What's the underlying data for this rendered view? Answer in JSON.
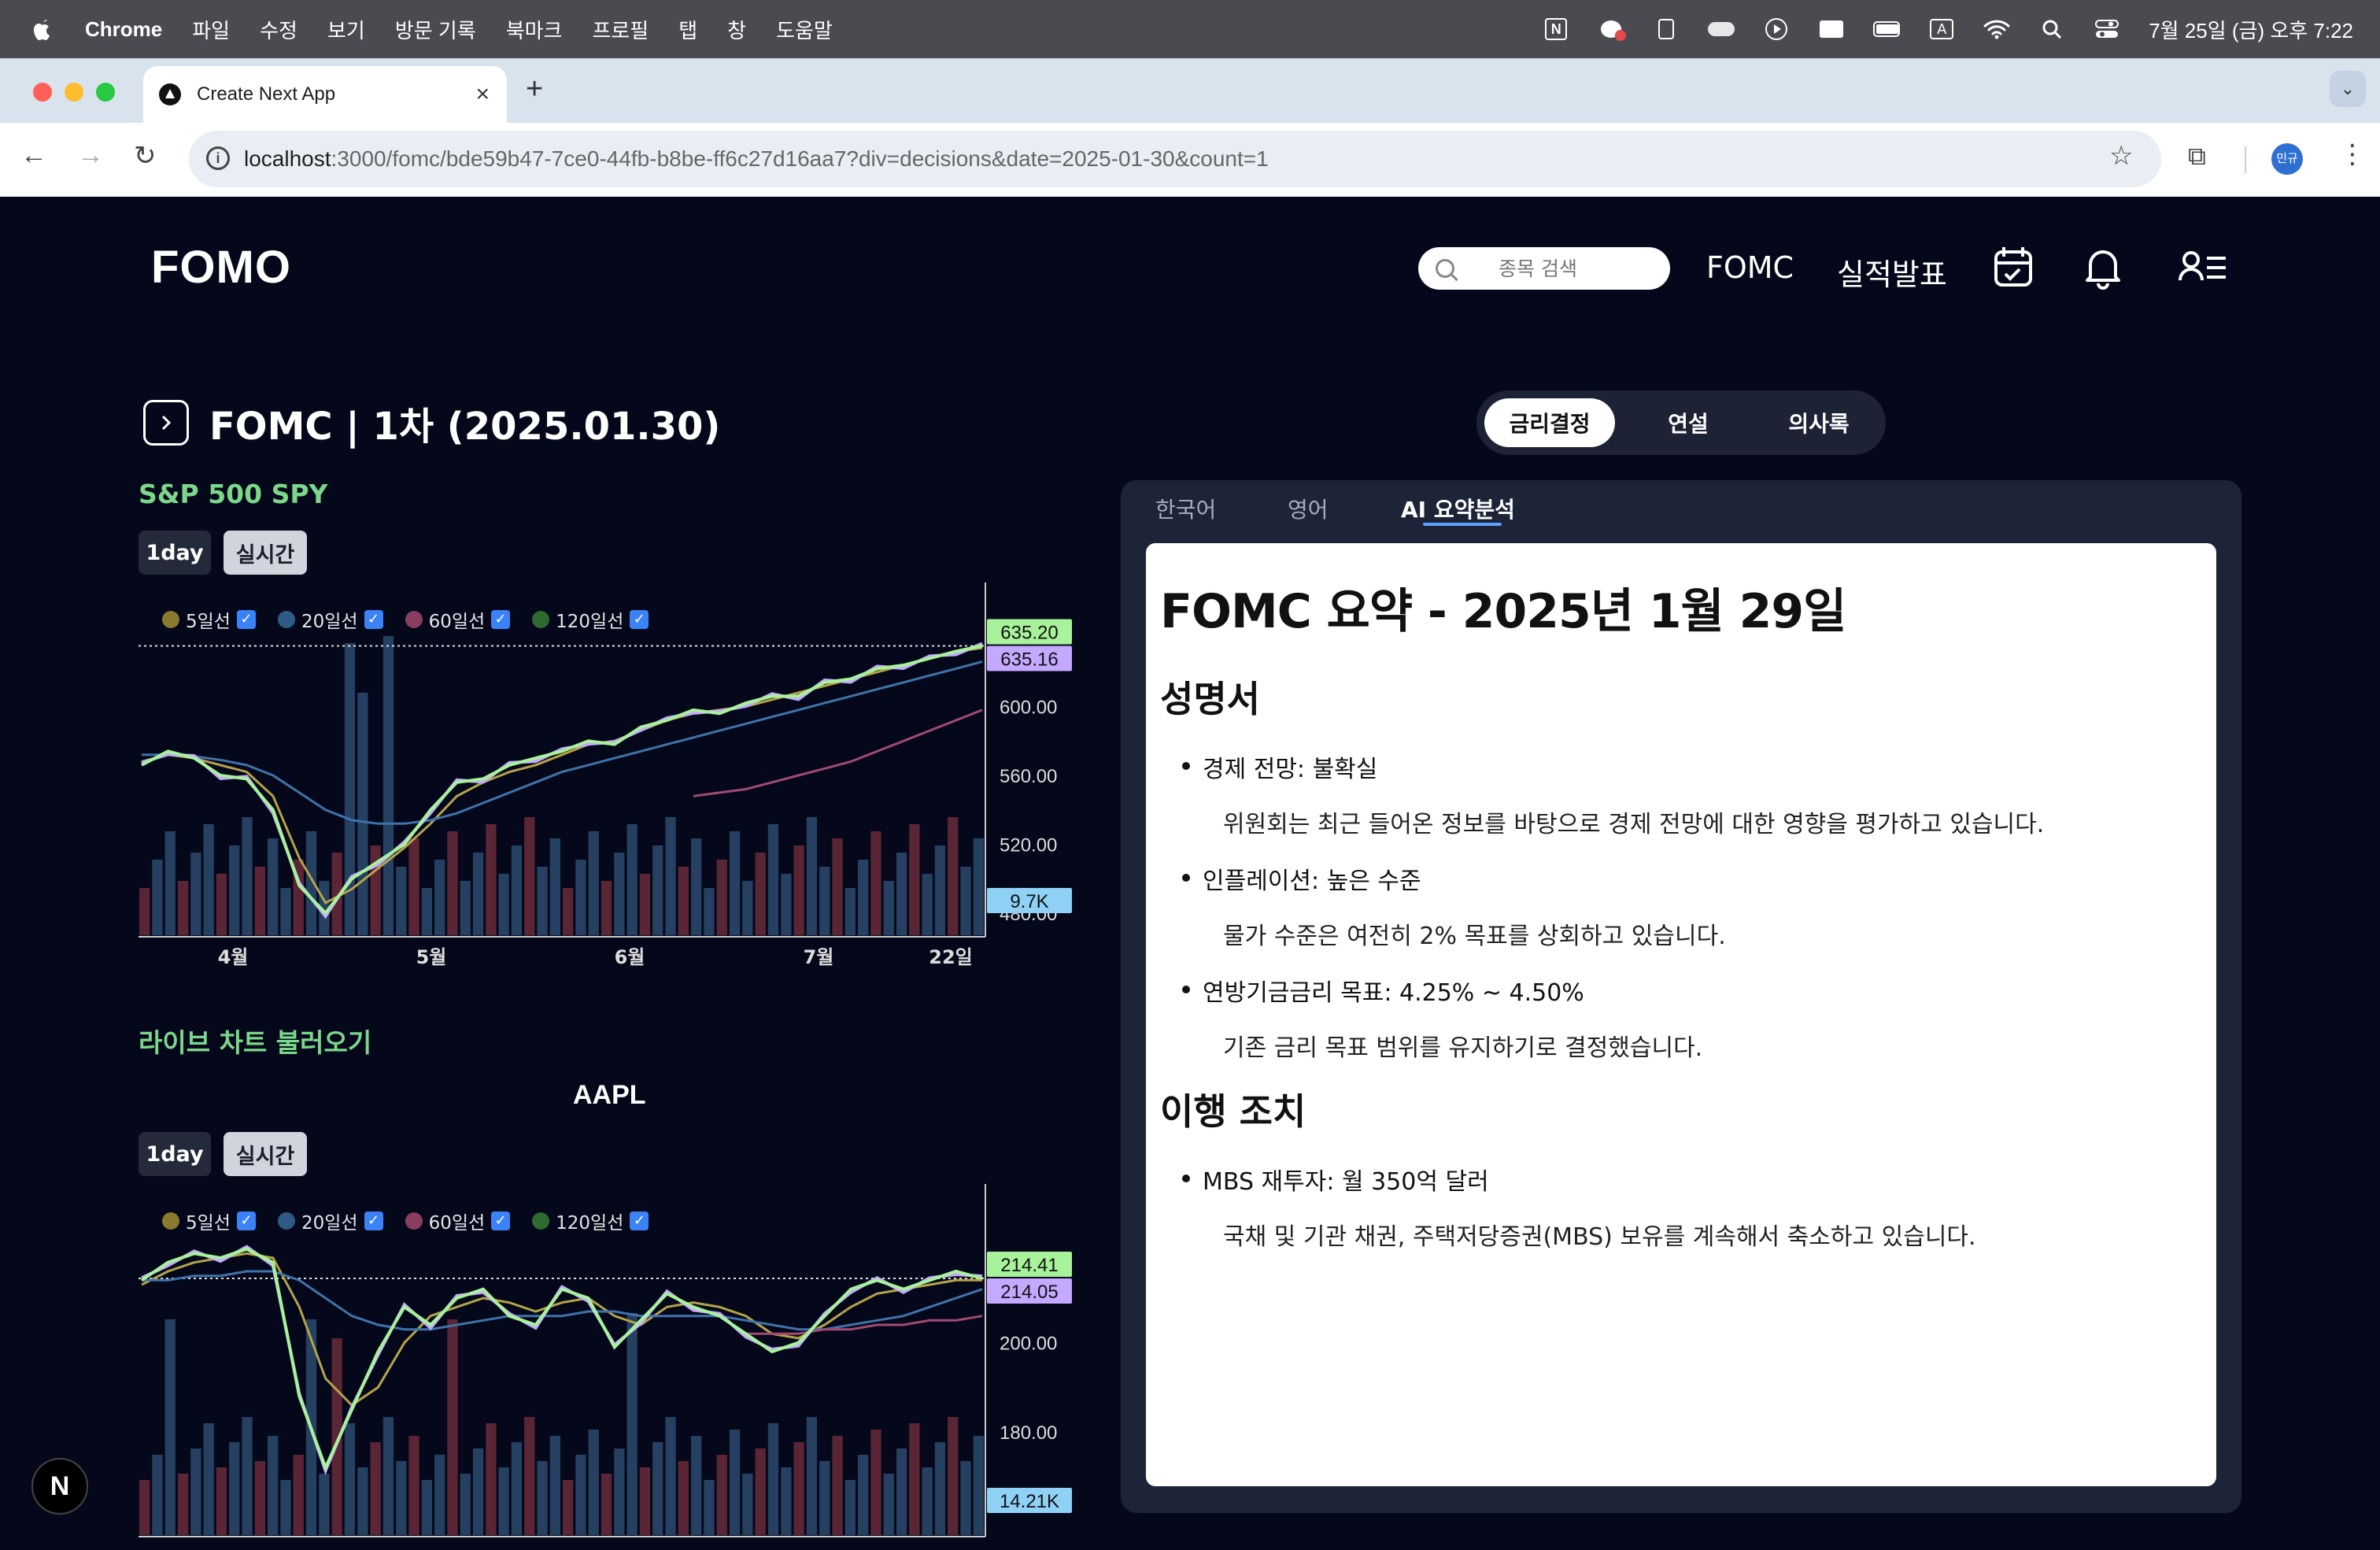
{
  "menubar": {
    "app": "Chrome",
    "items": [
      "파일",
      "수정",
      "보기",
      "방문 기록",
      "북마크",
      "프로필",
      "탭",
      "창",
      "도움말"
    ],
    "clock": "7월 25일 (금) 오후 7:22",
    "input_indicator": "A"
  },
  "browser": {
    "tab_title": "Create Next App",
    "url_host": "localhost",
    "url_rest": ":3000/fomc/bde59b47-7ce0-44fb-b8be-ff6c27d16aa7?div=decisions&date=2025-01-30&count=1",
    "profile_label": "민규"
  },
  "site": {
    "logo": "FOMO",
    "search_placeholder": "종목 검색",
    "nav": [
      "FOMC",
      "실적발표"
    ]
  },
  "fomc": {
    "title": "FOMC | 1차 (2025.01.30)",
    "segments": [
      "금리결정",
      "연설",
      "의사록"
    ],
    "active_segment": "금리결정",
    "lang_tabs": [
      "한국어",
      "영어",
      "AI 요약분석"
    ],
    "active_lang": "AI 요약분석"
  },
  "chart_spy": {
    "heading": "S&P 500 SPY",
    "btn_1day": "1day",
    "btn_live": "실시간",
    "legend": [
      {
        "label": "5일선",
        "color": "#8a7a2e"
      },
      {
        "label": "20일선",
        "color": "#2e5a86"
      },
      {
        "label": "60일선",
        "color": "#8a3d5f"
      },
      {
        "label": "120일선",
        "color": "#2f6a2f"
      }
    ]
  },
  "chart_aapl": {
    "heading": "라이브 차트 불러오기",
    "symbol": "AAPL",
    "btn_1day": "1day",
    "btn_live": "실시간"
  },
  "chart_data": [
    {
      "type": "line",
      "title": "S&P 500 SPY",
      "x_ticks": [
        "4월",
        "5월",
        "6월",
        "7월",
        "22일"
      ],
      "y_ticks": [
        "600.00",
        "560.00",
        "520.00",
        "480.00"
      ],
      "ylim": [
        480,
        640
      ],
      "price_label_last": "635.20",
      "price_label_ma": "635.16",
      "volume_label": "9.7K",
      "series": [
        {
          "name": "5일선",
          "values": [
            568,
            572,
            570,
            566,
            562,
            548,
            512,
            486,
            494,
            506,
            518,
            532,
            548,
            556,
            562,
            566,
            572,
            578,
            580,
            586,
            592,
            596,
            598,
            600,
            604,
            608,
            612,
            616,
            620,
            624,
            628,
            632,
            634
          ]
        },
        {
          "name": "20일선",
          "values": [
            572,
            572,
            571,
            569,
            566,
            560,
            550,
            540,
            534,
            532,
            532,
            534,
            538,
            544,
            550,
            556,
            562,
            566,
            570,
            574,
            578,
            582,
            586,
            590,
            594,
            598,
            602,
            606,
            610,
            614,
            618,
            622,
            626
          ]
        },
        {
          "name": "60일선",
          "values": [
            null,
            null,
            null,
            null,
            null,
            null,
            null,
            null,
            null,
            null,
            null,
            null,
            null,
            null,
            null,
            null,
            null,
            null,
            null,
            null,
            null,
            548,
            550,
            552,
            556,
            560,
            564,
            568,
            574,
            580,
            586,
            592,
            598
          ]
        }
      ],
      "price": [
        566,
        574,
        570,
        560,
        558,
        540,
        496,
        480,
        500,
        510,
        520,
        540,
        556,
        558,
        566,
        570,
        574,
        580,
        578,
        588,
        592,
        598,
        596,
        602,
        606,
        606,
        614,
        616,
        622,
        624,
        628,
        632,
        635.2
      ]
    },
    {
      "type": "line",
      "title": "AAPL",
      "x_ticks": [],
      "y_ticks": [
        "200.00",
        "180.00"
      ],
      "ylim": [
        165,
        225
      ],
      "price_label_last": "214.41",
      "price_label_ma": "214.05",
      "volume_label": "14.21K",
      "price": [
        214,
        218,
        220,
        219,
        221,
        218,
        188,
        172,
        185,
        198,
        208,
        204,
        210,
        212,
        206,
        204,
        212,
        210,
        199,
        205,
        211,
        208,
        206,
        202,
        198,
        200,
        206,
        212,
        214,
        212,
        214,
        216,
        214.41
      ],
      "series": [
        {
          "name": "5일선",
          "values": [
            213,
            216,
            218,
            219,
            220,
            219,
            208,
            192,
            186,
            190,
            200,
            206,
            208,
            210,
            209,
            207,
            209,
            210,
            206,
            204,
            208,
            209,
            208,
            206,
            202,
            201,
            204,
            208,
            211,
            212,
            213,
            214,
            214
          ]
        },
        {
          "name": "20일선",
          "values": [
            214,
            214,
            215,
            215,
            216,
            216,
            214,
            210,
            206,
            204,
            203,
            203,
            204,
            205,
            206,
            206,
            206,
            207,
            207,
            206,
            206,
            206,
            206,
            205,
            204,
            203,
            203,
            204,
            205,
            206,
            208,
            210,
            212
          ]
        },
        {
          "name": "60일선",
          "values": [
            null,
            null,
            null,
            null,
            null,
            null,
            null,
            null,
            null,
            null,
            null,
            null,
            null,
            null,
            null,
            null,
            null,
            null,
            null,
            null,
            null,
            null,
            null,
            202,
            202,
            202,
            203,
            203,
            204,
            204,
            205,
            205,
            206
          ]
        }
      ]
    }
  ],
  "summary": {
    "h1": "FOMC 요약 - 2025년 1월 29일",
    "section1": "성명서",
    "items1": [
      {
        "bullet": "경제 전망: 불확실",
        "para": "위원회는 최근 들어온 정보를 바탕으로 경제 전망에 대한 영향을 평가하고 있습니다."
      },
      {
        "bullet": "인플레이션: 높은 수준",
        "para": "물가 수준은 여전히 2% 목표를 상회하고 있습니다."
      },
      {
        "bullet": "연방기금금리 목표: 4.25% ~ 4.50%",
        "para": "기존 금리 목표 범위를 유지하기로 결정했습니다."
      }
    ],
    "section2": "이행 조치",
    "items2": [
      {
        "bullet": "MBS 재투자: 월 350억 달러",
        "para": "국채 및 기관 채권, 주택저당증권(MBS) 보유를 계속해서 축소하고 있습니다."
      }
    ]
  },
  "nextjs_badge": "N"
}
